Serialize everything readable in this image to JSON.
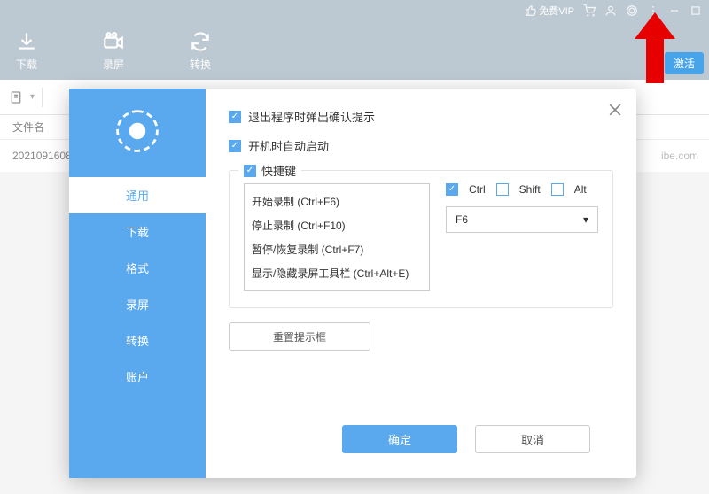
{
  "titlebar": {
    "vip_label": "免费VIP",
    "icons": [
      "thumbs-up",
      "cart",
      "user",
      "theme",
      "more",
      "minimize",
      "maximize"
    ]
  },
  "toolbar": {
    "tabs": [
      {
        "label": "下载",
        "icon": "download"
      },
      {
        "label": "录屏",
        "icon": "camera"
      },
      {
        "label": "转换",
        "icon": "convert"
      }
    ],
    "activate_label": "激活"
  },
  "content": {
    "header_filename": "文件名",
    "row_id": "2021091608",
    "row_url": "ibe.com"
  },
  "settings": {
    "side_items": [
      "通用",
      "下载",
      "格式",
      "录屏",
      "转换",
      "账户"
    ],
    "opt_confirm_exit": "退出程序时弹出确认提示",
    "opt_autostart": "开机时自动启动",
    "hotkeys_legend": "快捷键",
    "hotkey_list": [
      "开始录制 (Ctrl+F6)",
      "停止录制 (Ctrl+F10)",
      "暂停/恢复录制 (Ctrl+F7)",
      "显示/隐藏录屏工具栏 (Ctrl+Alt+E)"
    ],
    "mod_ctrl": "Ctrl",
    "mod_shift": "Shift",
    "mod_alt": "Alt",
    "keyselect_value": "F6",
    "reset_label": "重置提示框",
    "ok_label": "确定",
    "cancel_label": "取消"
  }
}
